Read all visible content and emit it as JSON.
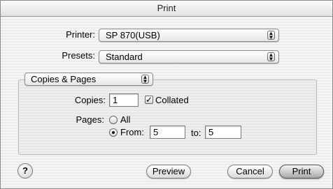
{
  "window": {
    "title": "Print"
  },
  "printer": {
    "label": "Printer:",
    "value": "SP 870(USB)"
  },
  "presets": {
    "label": "Presets:",
    "value": "Standard"
  },
  "section": {
    "value": "Copies & Pages"
  },
  "copies": {
    "label": "Copies:",
    "value": "1",
    "collated_label": "Collated",
    "collated": true
  },
  "pages": {
    "label": "Pages:",
    "all_label": "All",
    "from_label": "From:",
    "to_label": "to:",
    "from_value": "5",
    "to_value": "5",
    "selected": "from"
  },
  "buttons": {
    "help": "?",
    "preview": "Preview",
    "cancel": "Cancel",
    "print": "Print"
  },
  "icons": {
    "popup_arrow": "up-down-arrows-icon",
    "check": "checkmark-icon"
  }
}
